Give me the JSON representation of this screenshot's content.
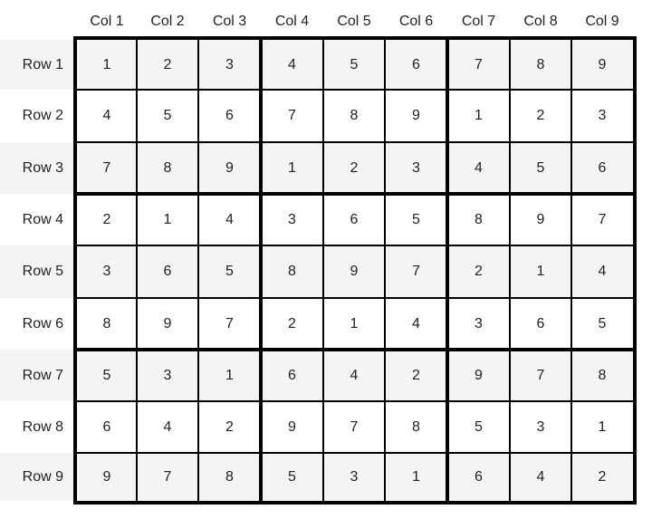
{
  "columns": [
    "Col 1",
    "Col 2",
    "Col 3",
    "Col 4",
    "Col 5",
    "Col 6",
    "Col 7",
    "Col 8",
    "Col 9"
  ],
  "rows": [
    "Row 1",
    "Row 2",
    "Row 3",
    "Row 4",
    "Row 5",
    "Row 6",
    "Row 7",
    "Row 8",
    "Row 9"
  ],
  "grid": [
    [
      "1",
      "2",
      "3",
      "4",
      "5",
      "6",
      "7",
      "8",
      "9"
    ],
    [
      "4",
      "5",
      "6",
      "7",
      "8",
      "9",
      "1",
      "2",
      "3"
    ],
    [
      "7",
      "8",
      "9",
      "1",
      "2",
      "3",
      "4",
      "5",
      "6"
    ],
    [
      "2",
      "1",
      "4",
      "3",
      "6",
      "5",
      "8",
      "9",
      "7"
    ],
    [
      "3",
      "6",
      "5",
      "8",
      "9",
      "7",
      "2",
      "1",
      "4"
    ],
    [
      "8",
      "9",
      "7",
      "2",
      "1",
      "4",
      "3",
      "6",
      "5"
    ],
    [
      "5",
      "3",
      "1",
      "6",
      "4",
      "2",
      "9",
      "7",
      "8"
    ],
    [
      "6",
      "4",
      "2",
      "9",
      "7",
      "8",
      "5",
      "3",
      "1"
    ],
    [
      "9",
      "7",
      "8",
      "5",
      "3",
      "1",
      "6",
      "4",
      "2"
    ]
  ],
  "colors": {
    "shaded_row": "#f4f4f4",
    "plain_row": "#ffffff",
    "grid_line": "#000000",
    "text": "#222222"
  }
}
